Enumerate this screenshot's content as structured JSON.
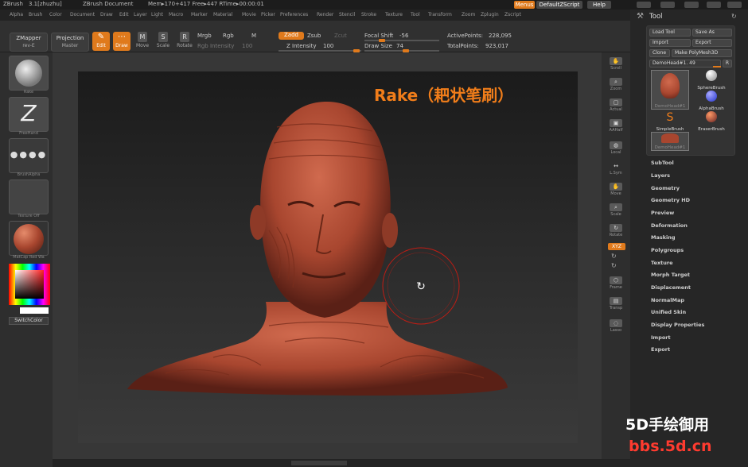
{
  "titlebar": {
    "app": "ZBrush",
    "version": "3.1[zhuzhu]",
    "document": "ZBrush Document",
    "stats": "Mem▸170+417 Free▸447 RTime▸00:00:01",
    "menus_btn": "Menus",
    "script_btn": "DefaultZScript",
    "help_btn": "Help"
  },
  "menubar": [
    "Alpha",
    "Brush",
    "Color",
    "Document",
    "Draw",
    "Edit",
    "Layer",
    "Light",
    "Macro",
    "Marker",
    "Material",
    "Movie",
    "Picker",
    "Preferences",
    "Render",
    "Stencil",
    "Stroke",
    "Texture",
    "Tool",
    "Transform",
    "Zoom",
    "Zplugin",
    "Zscript"
  ],
  "toolbar": {
    "zmapper": "ZMapper",
    "zmapper_sub": "rev-E",
    "projection": "Projection",
    "projection_sub": "Master",
    "edit": "Edit",
    "draw": "Draw",
    "move": "Move",
    "scale": "Scale",
    "rotate": "Rotate",
    "mrgb": "Mrgb",
    "rgb": "Rgb",
    "m": "M",
    "rgb_intensity": "Rgb Intensity",
    "rgb_intensity_val": "100",
    "zadd": "Zadd",
    "zsub": "Zsub",
    "zcut": "Zcut",
    "z_intensity": "Z Intensity",
    "z_intensity_val": "100",
    "focal_shift": "Focal Shift",
    "focal_shift_val": "-56",
    "draw_size": "Draw Size",
    "draw_size_val": "74",
    "active_points": "ActivePoints:",
    "active_points_val": "228,095",
    "total_points": "TotalPoints:",
    "total_points_val": "923,017"
  },
  "leftshelf": {
    "brush": "Rake",
    "stroke": "FreeHand",
    "alpha": "BrushAlpha",
    "texture": "Texture Off",
    "material": "MatCap Red Wa",
    "switchcolor": "SwitchColor"
  },
  "overlay": {
    "title": "Rake（耙状笔刷）",
    "watermark1": "5D手绘御用",
    "watermark2": "bbs.5d.cn"
  },
  "rightshelf": [
    "Scroll",
    "Zoom",
    "Actual",
    "AAHalf",
    "Local",
    "L.Sym",
    "Move",
    "Scale",
    "Rotate",
    "XYZ",
    "",
    "",
    "Frame",
    "Transp",
    "Lasso"
  ],
  "toolpanel": {
    "title": "Tool",
    "load_tool": "Load Tool",
    "save_as": "Save As",
    "import": "Import",
    "export": "Export",
    "clone": "Clone",
    "make_polymesh": "Make PolyMesh3D",
    "current_tool": "DemoHead#1. 49",
    "r_btn": "R",
    "thumbs": [
      "DemoHead#1",
      "SphereBrush",
      "",
      "AlphaBrush",
      "SimpleBrush",
      "EraserBrush",
      "DemoHead#1"
    ],
    "items": [
      "SubTool",
      "Layers",
      "Geometry",
      "Geometry HD",
      "Preview",
      "Deformation",
      "Masking",
      "Polygroups",
      "Texture",
      "Morph Target",
      "Displacement",
      "NormalMap",
      "Unified Skin",
      "Display Properties",
      "Import",
      "Export"
    ]
  },
  "colors": {
    "accent": "#e07a1c",
    "clay": "#a8462f",
    "title_orange": "#f07d1a",
    "watermark": "#ff3b2f"
  }
}
